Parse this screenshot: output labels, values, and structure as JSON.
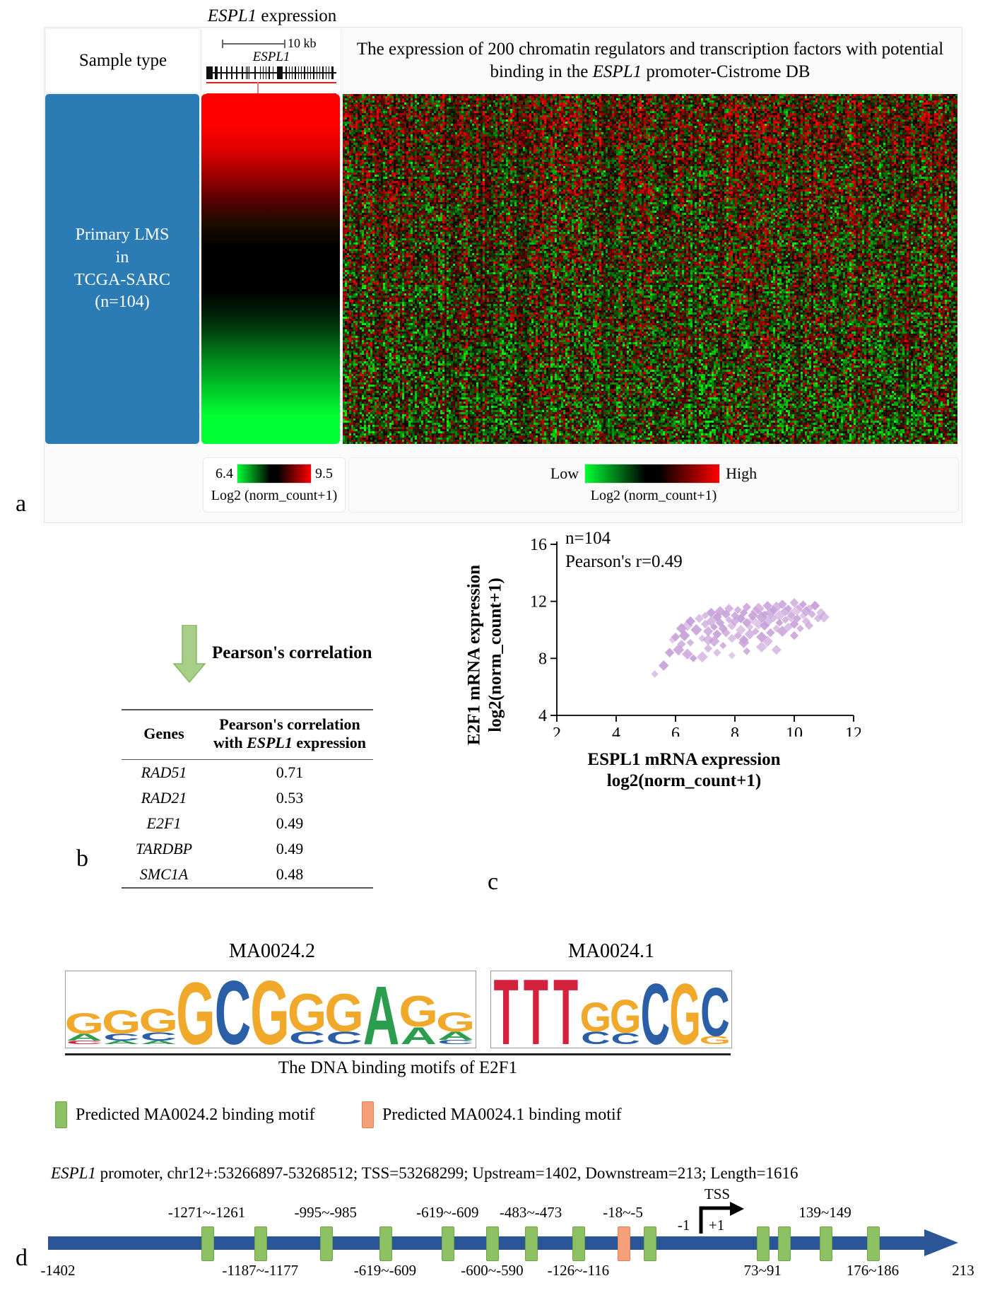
{
  "panel_a": {
    "letter": "a",
    "sample_type_label": "Sample type",
    "sample_block_lines": [
      "Primary LMS",
      "in",
      "TCGA-SARC",
      "(n=104)"
    ],
    "espl1_title_italic": "ESPL1",
    "espl1_title_rest": " expression",
    "scalebar_label": "10 kb",
    "gene_name": "ESPL1",
    "heatmap_title_pre": "The expression of 200 chromatin regulators and transcription factors with potential binding in the ",
    "heatmap_title_italic": "ESPL1",
    "heatmap_title_post": " promoter-Cistrome DB",
    "legend_small": {
      "min": "6.4",
      "max": "9.5",
      "caption": "Log2 (norm_count+1)"
    },
    "legend_big": {
      "min": "Low",
      "max": "High",
      "caption": "Log2 (norm_count+1)"
    },
    "colors": {
      "sample_block": "#2b7cb5",
      "heat_low": "#00ff33",
      "heat_mid": "#000000",
      "heat_high": "#ff0000",
      "gene_track_red": "#e81d1d"
    }
  },
  "panel_b": {
    "letter": "b",
    "arrow_label": "Pearson's correlation",
    "arrow_color": "#a8cf87",
    "table": {
      "headers": [
        "Genes",
        "Pearson's correlation with ESPL1 expression"
      ],
      "header_col2_line1": "Pearson's correlation",
      "header_col2_line2_pre": "with ",
      "header_col2_line2_italic": "ESPL1",
      "header_col2_line2_post": " expression",
      "rows": [
        {
          "gene": "RAD51",
          "value": "0.71"
        },
        {
          "gene": "RAD21",
          "value": "0.53"
        },
        {
          "gene": "E2F1",
          "value": "0.49"
        },
        {
          "gene": "TARDBP",
          "value": "0.49"
        },
        {
          "gene": "SMC1A",
          "value": "0.48"
        }
      ]
    }
  },
  "panel_c": {
    "letter": "c",
    "annotation_n": "n=104",
    "annotation_r": "Pearson's r=0.49",
    "xlabel_line1": "ESPL1 mRNA expression",
    "xlabel_line2": "log2(norm_count+1)",
    "ylabel_line1": "E2F1 mRNA expression",
    "ylabel_line2": "log2(norm_count+1)",
    "point_color": "#c79fd8"
  },
  "chart_data": {
    "type": "scatter",
    "title": "",
    "xlabel": "ESPL1 mRNA expression log2(norm_count+1)",
    "ylabel": "E2F1 mRNA expression log2(norm_count+1)",
    "xlim": [
      2,
      12
    ],
    "ylim": [
      4,
      16
    ],
    "xticks": [
      2,
      4,
      6,
      8,
      10,
      12
    ],
    "yticks": [
      4,
      8,
      12,
      16
    ],
    "grid": false,
    "legend": false,
    "n": 104,
    "pearson_r": 0.49,
    "marker": "diamond",
    "color": "#c79fd8",
    "points": [
      [
        5.3,
        6.9
      ],
      [
        5.6,
        7.5
      ],
      [
        5.9,
        9.3
      ],
      [
        6.0,
        9.5
      ],
      [
        6.1,
        8.6
      ],
      [
        6.2,
        10.1
      ],
      [
        6.3,
        9.6
      ],
      [
        6.4,
        10.3
      ],
      [
        6.5,
        9.1
      ],
      [
        6.5,
        10.6
      ],
      [
        6.6,
        8.0
      ],
      [
        6.7,
        10.0
      ],
      [
        6.8,
        10.8
      ],
      [
        6.9,
        9.4
      ],
      [
        7.0,
        10.4
      ],
      [
        7.0,
        11.0
      ],
      [
        7.1,
        9.9
      ],
      [
        7.1,
        8.7
      ],
      [
        7.2,
        10.6
      ],
      [
        7.2,
        11.2
      ],
      [
        7.3,
        9.2
      ],
      [
        7.3,
        10.2
      ],
      [
        7.4,
        10.9
      ],
      [
        7.4,
        9.7
      ],
      [
        7.5,
        11.3
      ],
      [
        7.5,
        10.5
      ],
      [
        7.6,
        8.9
      ],
      [
        7.6,
        10.1
      ],
      [
        7.7,
        11.1
      ],
      [
        7.7,
        9.8
      ],
      [
        7.8,
        10.7
      ],
      [
        7.8,
        11.5
      ],
      [
        7.9,
        10.3
      ],
      [
        7.9,
        9.4
      ],
      [
        8.0,
        11.0
      ],
      [
        8.0,
        10.6
      ],
      [
        8.1,
        9.6
      ],
      [
        8.1,
        11.4
      ],
      [
        8.2,
        10.8
      ],
      [
        8.2,
        10.0
      ],
      [
        8.3,
        11.2
      ],
      [
        8.3,
        9.1
      ],
      [
        8.4,
        10.5
      ],
      [
        8.4,
        11.6
      ],
      [
        8.5,
        10.2
      ],
      [
        8.5,
        9.7
      ],
      [
        8.6,
        11.0
      ],
      [
        8.6,
        10.7
      ],
      [
        8.7,
        11.3
      ],
      [
        8.7,
        9.9
      ],
      [
        8.8,
        10.4
      ],
      [
        8.8,
        11.5
      ],
      [
        8.9,
        10.9
      ],
      [
        8.9,
        9.5
      ],
      [
        9.0,
        11.1
      ],
      [
        9.0,
        10.3
      ],
      [
        9.1,
        11.7
      ],
      [
        9.1,
        10.6
      ],
      [
        9.2,
        9.8
      ],
      [
        9.2,
        11.2
      ],
      [
        9.3,
        10.8
      ],
      [
        9.3,
        11.4
      ],
      [
        9.4,
        10.1
      ],
      [
        9.4,
        11.6
      ],
      [
        9.5,
        10.5
      ],
      [
        9.5,
        11.0
      ],
      [
        9.6,
        11.8
      ],
      [
        9.6,
        9.9
      ],
      [
        9.7,
        10.7
      ],
      [
        9.7,
        11.3
      ],
      [
        9.8,
        10.2
      ],
      [
        9.8,
        11.5
      ],
      [
        9.9,
        10.9
      ],
      [
        9.9,
        11.1
      ],
      [
        10.0,
        11.9
      ],
      [
        10.0,
        10.4
      ],
      [
        10.1,
        11.4
      ],
      [
        10.1,
        10.8
      ],
      [
        10.2,
        11.6
      ],
      [
        10.2,
        10.1
      ],
      [
        10.3,
        11.0
      ],
      [
        10.3,
        11.8
      ],
      [
        10.4,
        10.6
      ],
      [
        10.4,
        11.3
      ],
      [
        10.5,
        11.5
      ],
      [
        10.5,
        10.3
      ],
      [
        10.6,
        11.1
      ],
      [
        10.7,
        11.7
      ],
      [
        10.8,
        10.8
      ],
      [
        10.9,
        11.2
      ],
      [
        11.0,
        10.9
      ],
      [
        6.4,
        8.3
      ],
      [
        6.9,
        8.1
      ],
      [
        7.4,
        8.4
      ],
      [
        7.9,
        8.2
      ],
      [
        8.4,
        8.5
      ],
      [
        8.9,
        8.8
      ],
      [
        9.4,
        8.6
      ],
      [
        6.2,
        9.0
      ],
      [
        7.1,
        9.3
      ],
      [
        8.3,
        9.3
      ],
      [
        9.1,
        9.2
      ],
      [
        10.0,
        9.6
      ],
      [
        5.8,
        8.4
      ]
    ]
  },
  "panel_d": {
    "letter": "d",
    "motif1_title": "MA0024.2",
    "motif2_title": "MA0024.1",
    "motif_caption": "The DNA binding motifs of E2F1",
    "legend_green": "Predicted MA0024.2 binding motif",
    "legend_orange": "Predicted MA0024.1 binding motif",
    "legend_green_color": "#8dc163",
    "legend_orange_color": "#f5a07a",
    "promoter_text_italic": "ESPL1",
    "promoter_text_rest": " promoter, chr12+:53266897-53268512; TSS=53268299; Upstream=1402, Downstream=213; Length=1616",
    "axis_start": "-1402",
    "axis_end": "213",
    "tss_label": "TSS",
    "tss_minus1": "-1",
    "tss_plus1": "+1",
    "axis_color": "#2b5597",
    "motif1_logo": [
      {
        "stack": [
          [
            "G",
            0.3,
            "#f0a92b"
          ],
          [
            "A",
            0.1,
            "#2a9d4f"
          ],
          [
            "C",
            0.05,
            "#d4213d"
          ]
        ]
      },
      {
        "stack": [
          [
            "G",
            0.34,
            "#f0a92b"
          ],
          [
            "C",
            0.1,
            "#2a5fa8"
          ],
          [
            "A",
            0.05,
            "#2a9d4f"
          ]
        ]
      },
      {
        "stack": [
          [
            "G",
            0.34,
            "#f0a92b"
          ],
          [
            "C",
            0.12,
            "#2a5fa8"
          ],
          [
            "A",
            0.05,
            "#2a9d4f"
          ]
        ]
      },
      {
        "stack": [
          [
            "G",
            0.9,
            "#f0a92b"
          ]
        ]
      },
      {
        "stack": [
          [
            "C",
            0.92,
            "#2a5fa8"
          ]
        ]
      },
      {
        "stack": [
          [
            "G",
            0.92,
            "#f0a92b"
          ]
        ]
      },
      {
        "stack": [
          [
            "G",
            0.55,
            "#f0a92b"
          ],
          [
            "C",
            0.18,
            "#2a5fa8"
          ]
        ]
      },
      {
        "stack": [
          [
            "G",
            0.55,
            "#f0a92b"
          ],
          [
            "C",
            0.18,
            "#2a5fa8"
          ]
        ]
      },
      {
        "stack": [
          [
            "A",
            0.85,
            "#2a9d4f"
          ]
        ]
      },
      {
        "stack": [
          [
            "G",
            0.45,
            "#f0a92b"
          ],
          [
            "A",
            0.25,
            "#2a9d4f"
          ]
        ]
      },
      {
        "stack": [
          [
            "G",
            0.28,
            "#f0a92b"
          ],
          [
            "A",
            0.12,
            "#2a9d4f"
          ],
          [
            "C",
            0.06,
            "#2a5fa8"
          ]
        ]
      }
    ],
    "motif2_logo": [
      {
        "stack": [
          [
            "T",
            0.95,
            "#d4213d"
          ]
        ]
      },
      {
        "stack": [
          [
            "T",
            0.95,
            "#d4213d"
          ]
        ]
      },
      {
        "stack": [
          [
            "T",
            0.95,
            "#d4213d"
          ]
        ]
      },
      {
        "stack": [
          [
            "G",
            0.42,
            "#f0a92b"
          ],
          [
            "C",
            0.18,
            "#2a5fa8"
          ]
        ]
      },
      {
        "stack": [
          [
            "G",
            0.48,
            "#f0a92b"
          ],
          [
            "C",
            0.16,
            "#2a5fa8"
          ]
        ]
      },
      {
        "stack": [
          [
            "C",
            0.88,
            "#2a5fa8"
          ]
        ]
      },
      {
        "stack": [
          [
            "G",
            0.88,
            "#f0a92b"
          ]
        ]
      },
      {
        "stack": [
          [
            "C",
            0.7,
            "#2a5fa8"
          ],
          [
            "G",
            0.12,
            "#f0a92b"
          ]
        ]
      }
    ],
    "motif_sites": [
      {
        "pos": 0.255,
        "type": "green",
        "label": "-1271~-1261",
        "side": "top"
      },
      {
        "pos": 0.345,
        "type": "green",
        "label": "-1187~-1177",
        "side": "bottom"
      },
      {
        "pos": 0.455,
        "type": "green",
        "label": "-995~-985",
        "side": "top"
      },
      {
        "pos": 0.555,
        "type": "green",
        "label": "-619~-609",
        "side": "bottom"
      },
      {
        "pos": 0.66,
        "type": "green",
        "label": "-619~-609",
        "side": "top"
      },
      {
        "pos": 0.735,
        "type": "green",
        "label": "-600~-590",
        "side": "bottom"
      },
      {
        "pos": 0.8,
        "type": "green",
        "label": "-483~-473",
        "side": "top"
      },
      {
        "pos": 0.88,
        "type": "green",
        "label": "-126~-116",
        "side": "bottom"
      },
      {
        "pos": 0.955,
        "type": "orange",
        "label": "-18~-5",
        "side": "top"
      },
      {
        "pos": 1.0,
        "type": "green",
        "label": "",
        "side": "none"
      },
      {
        "pos": 1.19,
        "type": "green",
        "label": "73~91",
        "side": "bottom"
      },
      {
        "pos": 1.225,
        "type": "green",
        "label": "",
        "side": "none"
      },
      {
        "pos": 1.295,
        "type": "green",
        "label": "139~149",
        "side": "top"
      },
      {
        "pos": 1.375,
        "type": "green",
        "label": "176~186",
        "side": "bottom"
      }
    ]
  }
}
